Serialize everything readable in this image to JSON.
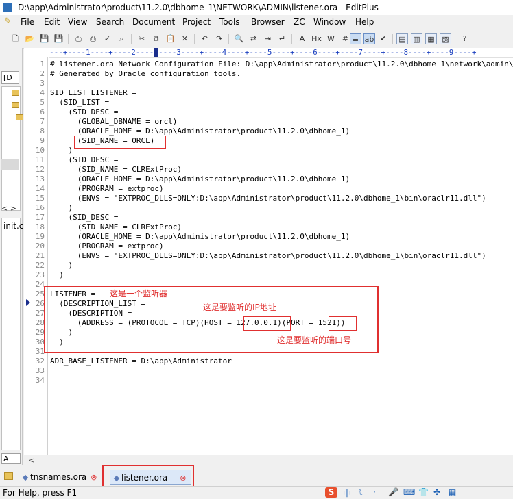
{
  "window": {
    "title": "D:\\app\\Administrator\\product\\11.2.0\\dbhome_1\\NETWORK\\ADMIN\\listener.ora - EditPlus"
  },
  "menu": [
    "File",
    "Edit",
    "View",
    "Search",
    "Document",
    "Project",
    "Tools",
    "Browser",
    "ZC",
    "Window",
    "Help"
  ],
  "ruler": "---+----1----+----2----+----3----+----4----+----5----+----6----+----7----+----8----+----9----+",
  "left_panel": {
    "dropdown": "[D",
    "arrows": "< >",
    "file": "init.c",
    "combo": "A"
  },
  "editor": {
    "lines": [
      {
        "n": "1",
        "text": "# listener.ora Network Configuration File: D:\\app\\Administrator\\product\\11.2.0\\dbhome_1\\network\\admin\\listener.ora"
      },
      {
        "n": "2",
        "text": "# Generated by Oracle configuration tools."
      },
      {
        "n": "3",
        "text": ""
      },
      {
        "n": "4",
        "text": "SID_LIST_LISTENER ="
      },
      {
        "n": "5",
        "text": "  (SID_LIST ="
      },
      {
        "n": "6",
        "text": "    (SID_DESC ="
      },
      {
        "n": "7",
        "text": "      (GLOBAL_DBNAME = orcl)"
      },
      {
        "n": "8",
        "text": "      (ORACLE_HOME = D:\\app\\Administrator\\product\\11.2.0\\dbhome_1)"
      },
      {
        "n": "9",
        "text": "      (SID_NAME = ORCL)"
      },
      {
        "n": "10",
        "text": "    )"
      },
      {
        "n": "11",
        "text": "    (SID_DESC ="
      },
      {
        "n": "12",
        "text": "      (SID_NAME = CLRExtProc)"
      },
      {
        "n": "13",
        "text": "      (ORACLE_HOME = D:\\app\\Administrator\\product\\11.2.0\\dbhome_1)"
      },
      {
        "n": "14",
        "text": "      (PROGRAM = extproc)"
      },
      {
        "n": "15",
        "text": "      (ENVS = \"EXTPROC_DLLS=ONLY:D:\\app\\Administrator\\product\\11.2.0\\dbhome_1\\bin\\oraclr11.dll\")"
      },
      {
        "n": "16",
        "text": "    )"
      },
      {
        "n": "17",
        "text": "    (SID_DESC ="
      },
      {
        "n": "18",
        "text": "      (SID_NAME = CLRExtProc)"
      },
      {
        "n": "19",
        "text": "      (ORACLE_HOME = D:\\app\\Administrator\\product\\11.2.0\\dbhome_1)"
      },
      {
        "n": "20",
        "text": "      (PROGRAM = extproc)"
      },
      {
        "n": "21",
        "text": "      (ENVS = \"EXTPROC_DLLS=ONLY:D:\\app\\Administrator\\product\\11.2.0\\dbhome_1\\bin\\oraclr11.dll\")"
      },
      {
        "n": "22",
        "text": "    )"
      },
      {
        "n": "23",
        "text": "  )"
      },
      {
        "n": "24",
        "text": ""
      },
      {
        "n": "25",
        "text": "LISTENER ="
      },
      {
        "n": "26",
        "text": "  (DESCRIPTION_LIST ="
      },
      {
        "n": "27",
        "text": "    (DESCRIPTION ="
      },
      {
        "n": "28",
        "text": "      (ADDRESS = (PROTOCOL = TCP)(HOST = 127.0.0.1)(PORT = 1521))"
      },
      {
        "n": "29",
        "text": "    )"
      },
      {
        "n": "30",
        "text": "  )"
      },
      {
        "n": "31",
        "text": ""
      },
      {
        "n": "32",
        "text": "ADR_BASE_LISTENER = D:\\app\\Administrator"
      },
      {
        "n": "33",
        "text": ""
      },
      {
        "n": "34",
        "text": ""
      }
    ]
  },
  "annotations": {
    "listener": "这是一个监听器",
    "ip": "这是要监听的IP地址",
    "port": "这是要监听的端口号"
  },
  "tabs": [
    {
      "label": "tnsnames.ora",
      "close": "⊗"
    },
    {
      "label": "listener.ora",
      "close": "⊗"
    }
  ],
  "status": {
    "text": "For Help, press F1",
    "ime_s": "S",
    "ime_zh": "中"
  },
  "colors": {
    "annotation": "#e03030",
    "ruler": "#1a3fbf"
  }
}
